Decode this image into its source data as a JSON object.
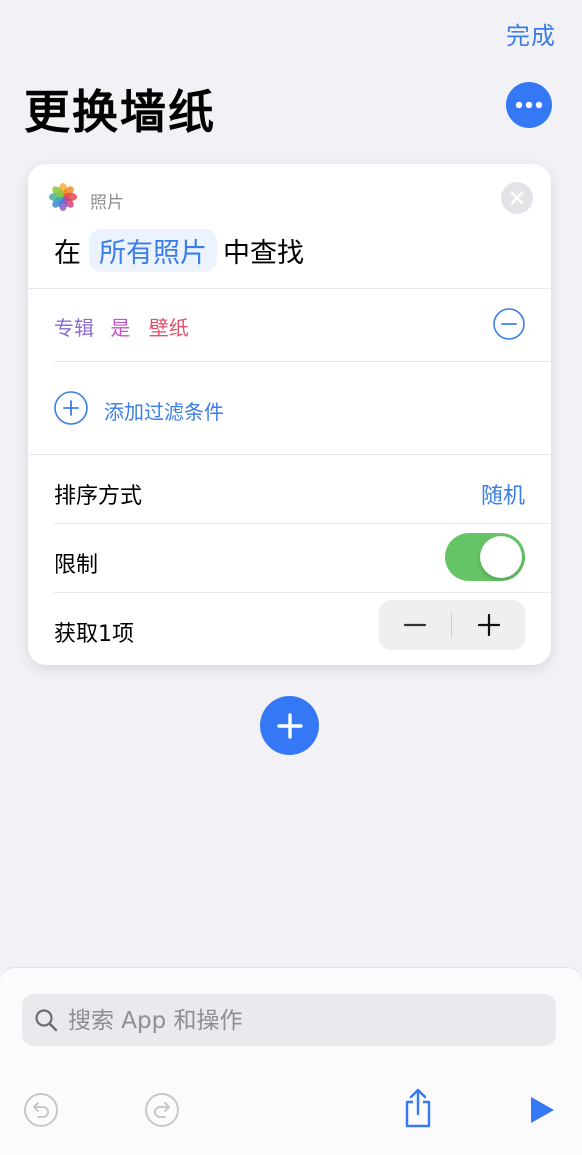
{
  "header": {
    "done_label": "完成",
    "title": "更换墙纸"
  },
  "action": {
    "app_label": "照片",
    "find_prefix": "在",
    "find_scope": "所有照片",
    "find_suffix": "中查找",
    "filter": {
      "field": "专辑",
      "operator": "是",
      "value": "壁纸"
    },
    "add_filter_label": "添加过滤条件",
    "sort_label": "排序方式",
    "sort_value": "随机",
    "limit_label": "限制",
    "limit_enabled": true,
    "count_label": "获取1项"
  },
  "search": {
    "placeholder": "搜索 App 和操作"
  },
  "colors": {
    "accent": "#3478f6",
    "link": "#3a7ee8",
    "toggle_on": "#65c466",
    "filter_field": "#8a6cd6",
    "filter_operator": "#c057c8",
    "filter_value": "#e0506a"
  },
  "icons": {
    "more": "ellipsis-icon",
    "app": "photos-app-icon",
    "close": "close-icon",
    "remove": "minus-circle-icon",
    "add_filter": "plus-circle-icon",
    "add_action": "plus-icon",
    "search": "search-icon",
    "undo": "undo-icon",
    "redo": "redo-icon",
    "share": "share-icon",
    "run": "play-icon"
  }
}
